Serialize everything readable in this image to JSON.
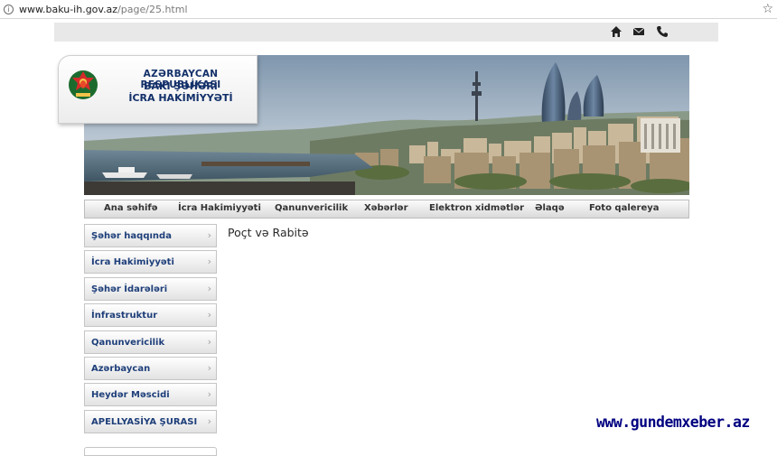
{
  "browser": {
    "url_host": "www.baku-ih.gov.az",
    "url_path": "/page/25.html"
  },
  "header": {
    "line1": "AZƏRBAYCAN RESPUBLİKASI",
    "line2": "BAKI ŞƏHƏRİ",
    "line3": "İCRA HAKİMİYYƏTİ"
  },
  "top_icons": [
    "home-icon",
    "mail-icon",
    "phone-icon"
  ],
  "nav": {
    "items": [
      {
        "label": "Ana səhifə"
      },
      {
        "label": "İcra Hakimiyyəti"
      },
      {
        "label": "Qanunvericilik"
      },
      {
        "label": "Xəbərlər"
      },
      {
        "label": "Elektron xidmətlər"
      },
      {
        "label": "Əlaqə"
      },
      {
        "label": "Foto qalereya"
      }
    ]
  },
  "sidebar": {
    "items": [
      {
        "label": "Şəhər haqqında"
      },
      {
        "label": "İcra Hakimiyyəti"
      },
      {
        "label": "Şəhər İdarələri"
      },
      {
        "label": "İnfrastruktur"
      },
      {
        "label": "Qanunvericilik"
      },
      {
        "label": "Azərbaycan"
      },
      {
        "label": "Heydər Məscidi"
      },
      {
        "label": "APELLYASİYA ŞURASI"
      }
    ]
  },
  "content": {
    "title": "Poçt və Rabitə"
  },
  "watermark": "www.gundemxeber.az",
  "colors": {
    "brand_text": "#13306a",
    "sidebar_text": "#1e3f7a",
    "watermark": "#000080"
  }
}
